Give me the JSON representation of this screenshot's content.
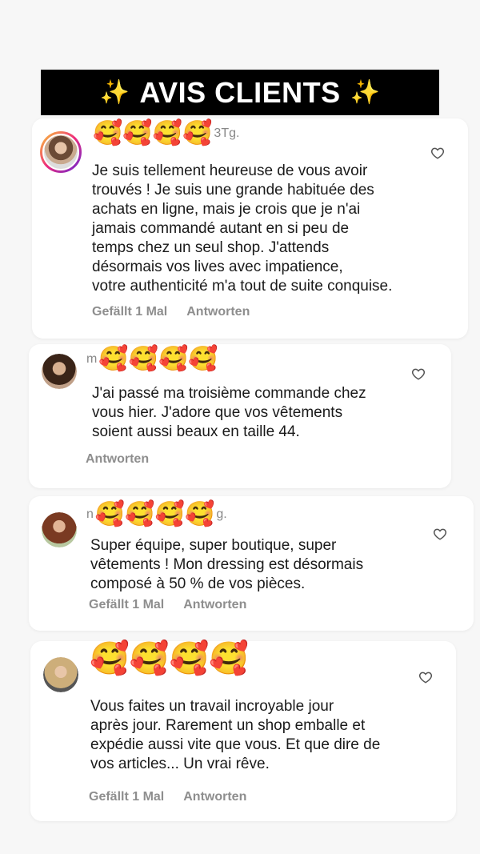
{
  "banner": {
    "sparkle_left": "✨",
    "title": "AVIS CLIENTS",
    "sparkle_right": "✨"
  },
  "reviews": [
    {
      "user_prefix": "",
      "emojis": "🥰🥰🥰🥰",
      "user_suffix": "3Tg.",
      "text": "Je suis tellement heureuse de vous avoir\ntrouvés ! Je suis une grande habituée des\nachats en ligne, mais je crois que je n'ai\njamais commandé autant en si peu de\ntemps chez un seul shop. J'attends\ndésormais vos lives avec impatience,\nvotre authenticité m'a tout de suite conquise.",
      "likes": "Gefällt 1 Mal",
      "reply": "Antworten"
    },
    {
      "user_prefix": "m",
      "emojis": "🥰🥰🥰🥰",
      "user_suffix": "",
      "text": "J'ai passé ma troisième commande chez\nvous hier. J'adore que vos vêtements\nsoient aussi beaux en taille 44.",
      "likes": "",
      "reply": "Antworten"
    },
    {
      "user_prefix": "n",
      "emojis": "🥰🥰🥰🥰",
      "user_suffix": "g.",
      "text": "Super équipe, super boutique, super\nvêtements ! Mon dressing est désormais\ncomposé à 50 % de vos pièces.",
      "likes": "Gefällt 1 Mal",
      "reply": "Antworten"
    },
    {
      "user_prefix": "",
      "emojis": "🥰🥰🥰🥰",
      "user_suffix": "",
      "text": "Vous faites un travail incroyable jour\naprès jour. Rarement un shop emballe et\nexpédie aussi vite que vous. Et que dire de\nvos articles... Un vrai rêve.",
      "likes": "Gefällt 1 Mal",
      "reply": "Antworten"
    }
  ],
  "icons": {
    "like": "heart-outline-icon"
  }
}
